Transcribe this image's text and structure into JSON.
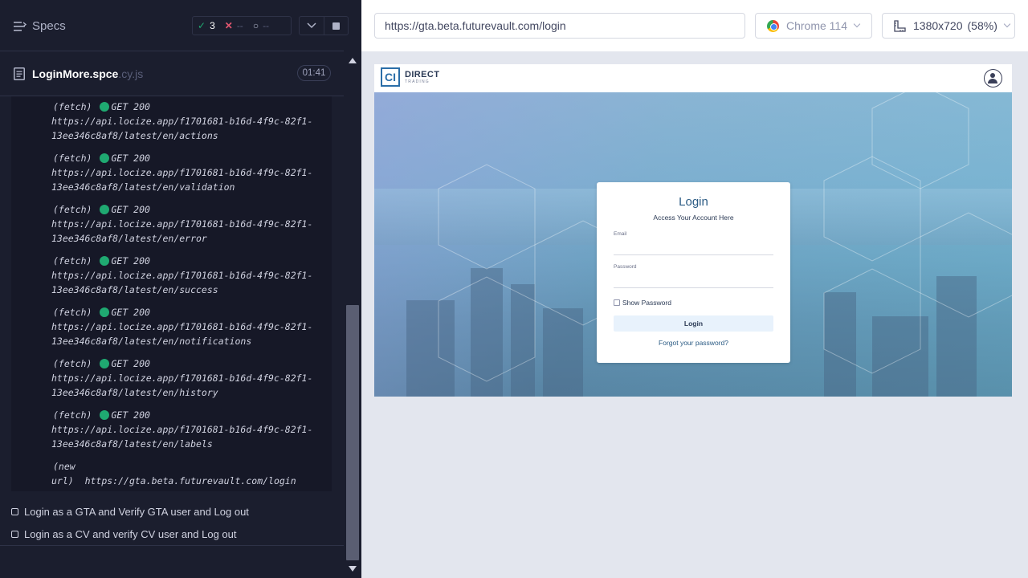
{
  "runner": {
    "header": {
      "title": "Specs",
      "stats": {
        "passed": "3",
        "failed": "--",
        "pending": "--"
      }
    },
    "spec": {
      "name": "LoginMore.spce",
      "ext": ".cy.js",
      "duration": "01:41"
    },
    "log": [
      {
        "kind": "(fetch)",
        "method": "GET 200",
        "url": "https://api.locize.app/f1701681-b16d-4f9c-82f1-\n13ee346c8af8/latest/en/actions"
      },
      {
        "kind": "(fetch)",
        "method": "GET 200",
        "url": "https://api.locize.app/f1701681-b16d-4f9c-82f1-\n13ee346c8af8/latest/en/validation"
      },
      {
        "kind": "(fetch)",
        "method": "GET 200",
        "url": "https://api.locize.app/f1701681-b16d-4f9c-82f1-\n13ee346c8af8/latest/en/error"
      },
      {
        "kind": "(fetch)",
        "method": "GET 200",
        "url": "https://api.locize.app/f1701681-b16d-4f9c-82f1-\n13ee346c8af8/latest/en/success"
      },
      {
        "kind": "(fetch)",
        "method": "GET 200",
        "url": "https://api.locize.app/f1701681-b16d-4f9c-82f1-\n13ee346c8af8/latest/en/notifications"
      },
      {
        "kind": "(fetch)",
        "method": "GET 200",
        "url": "https://api.locize.app/f1701681-b16d-4f9c-82f1-\n13ee346c8af8/latest/en/history"
      },
      {
        "kind": "(fetch)",
        "method": "GET 200",
        "url": "https://api.locize.app/f1701681-b16d-4f9c-82f1-\n13ee346c8af8/latest/en/labels"
      }
    ],
    "new_url": {
      "label1": "(new",
      "label2": "url)",
      "url": "https://gta.beta.futurevault.com/login"
    },
    "tests": [
      {
        "title": "Login as a GTA and Verify GTA user and Log out"
      },
      {
        "title": "Login as a CV and verify CV user and Log out"
      }
    ]
  },
  "browser": {
    "url": "https://gta.beta.futurevault.com/login",
    "browser_name": "Chrome 114",
    "viewport": "1380x720",
    "scale": "(58%)",
    "icons": {
      "browser": "chrome-icon",
      "viewport": "ruler-icon"
    }
  },
  "app": {
    "logo": {
      "mark": "CI",
      "word": "DIRECT",
      "sub": "TRADING"
    },
    "login": {
      "title": "Login",
      "subtitle": "Access Your Account Here",
      "email_label": "Email",
      "password_label": "Password",
      "show_password": "Show Password",
      "button": "Login",
      "forgot": "Forgot your password?"
    }
  },
  "colors": {
    "pass": "#1fa971",
    "fail": "#e45770",
    "runner_bg": "#1b1e2e",
    "link": "#2b5b84"
  }
}
